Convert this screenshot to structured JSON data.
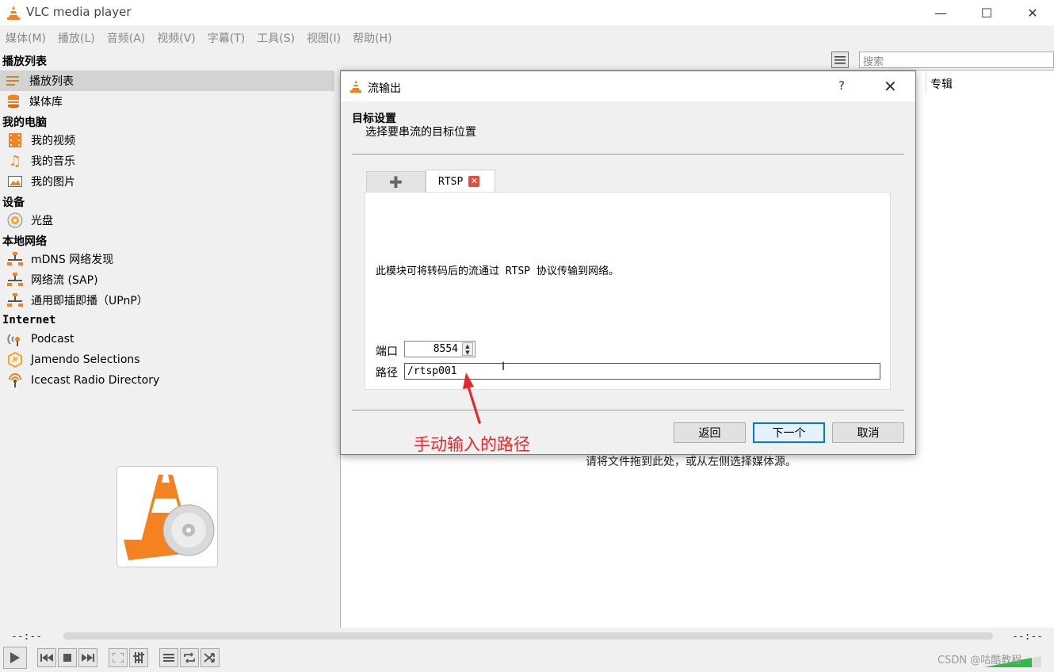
{
  "window": {
    "title": "VLC media player",
    "minimize_glyph": "—",
    "maximize_glyph": "☐",
    "close_glyph": "✕"
  },
  "menu": [
    "媒体(M)",
    "播放(L)",
    "音频(A)",
    "视频(V)",
    "字幕(T)",
    "工具(S)",
    "视图(I)",
    "帮助(H)"
  ],
  "sidebar": {
    "playlist_header": "播放列表",
    "playlist": "播放列表",
    "media_library": "媒体库",
    "my_computer_header": "我的电脑",
    "my_videos": "我的视频",
    "my_music": "我的音乐",
    "my_pictures": "我的图片",
    "devices_header": "设备",
    "disc": "光盘",
    "local_network_header": "本地网络",
    "mdns": "mDNS 网络发现",
    "sap": "网络流 (SAP)",
    "upnp": "通用即插即播（UPnP）",
    "internet_header": "Internet",
    "podcast": "Podcast",
    "jamendo": "Jamendo Selections",
    "icecast": "Icecast Radio Directory"
  },
  "main": {
    "search_placeholder": "搜索",
    "column_album": "专辑",
    "drop_hint": "请将文件拖到此处，或从左侧选择媒体源。"
  },
  "dialog": {
    "title": "流输出",
    "help_glyph": "?",
    "close_glyph": "✕",
    "heading": "目标设置",
    "subheading": "选择要串流的目标位置",
    "tab_add_glyph": "✚",
    "tab_rtsp": "RTSP",
    "tab_close_glyph": "✕",
    "module_description": "此模块可将转码后的流通过 RTSP 协议传输到网络。",
    "port_label": "端口",
    "port_value": "8554",
    "path_label": "路径",
    "path_value": "/rtsp001",
    "back_button": "返回",
    "next_button": "下一个",
    "cancel_button": "取消"
  },
  "annotation": {
    "text": "手动输入的路径",
    "color": "#e8262c"
  },
  "player": {
    "time_elapsed": "--:--",
    "time_total": "--:--",
    "watermark": "CSDN @咕酷教程"
  },
  "colors": {
    "vlc_orange": "#f58220",
    "selected_row": "#d3d3d3",
    "accent_blue": "#0078d7"
  }
}
